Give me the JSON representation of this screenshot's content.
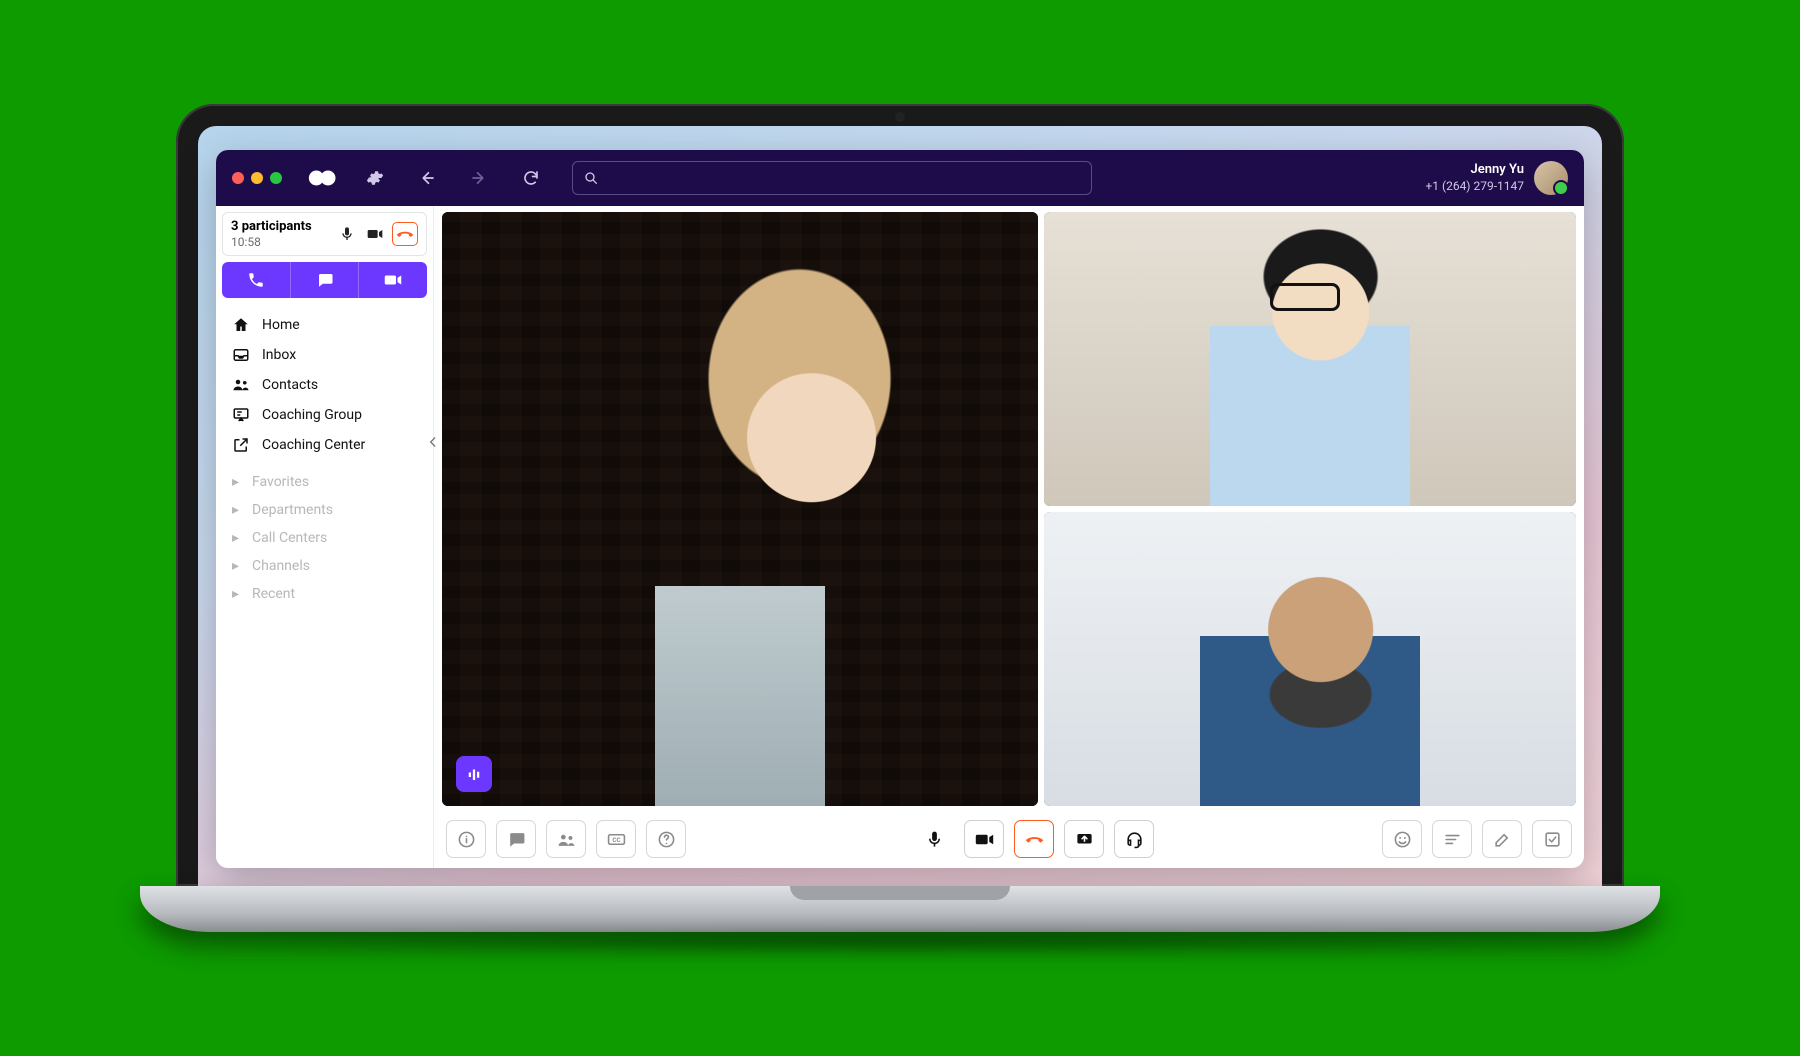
{
  "user": {
    "name": "Jenny Yu",
    "phone": "+1 (264) 279-1147"
  },
  "search": {
    "placeholder": ""
  },
  "call": {
    "participants_label": "3 participants",
    "duration": "10:58"
  },
  "nav": {
    "items": [
      {
        "label": "Home"
      },
      {
        "label": "Inbox"
      },
      {
        "label": "Contacts"
      },
      {
        "label": "Coaching Group"
      },
      {
        "label": "Coaching Center"
      }
    ]
  },
  "groups": {
    "items": [
      {
        "label": "Favorites"
      },
      {
        "label": "Departments"
      },
      {
        "label": "Call Centers"
      },
      {
        "label": "Channels"
      },
      {
        "label": "Recent"
      }
    ]
  },
  "icons": {
    "settings": "settings-icon",
    "back": "back-icon",
    "forward": "forward-icon",
    "refresh": "refresh-icon",
    "search": "search-icon",
    "phone": "phone-icon",
    "chat": "chat-icon",
    "video": "video-icon",
    "mic": "mic-icon",
    "hangup": "hangup-icon",
    "home": "home-icon",
    "inbox": "inbox-icon",
    "contacts": "contacts-icon",
    "whiteboard": "whiteboard-icon",
    "external": "external-link-icon"
  },
  "bottom_controls": {
    "left": [
      "info-icon",
      "chat-icon",
      "participants-icon",
      "cc-icon",
      "help-icon"
    ],
    "center": [
      "mic-icon",
      "video-icon",
      "hangup-icon",
      "share-screen-icon",
      "headset-icon"
    ],
    "right": [
      "emoji-icon",
      "notes-icon",
      "edit-icon",
      "task-icon"
    ]
  },
  "colors": {
    "accent": "#6c38ff",
    "hangup": "#ff5a1f",
    "titlebar": "#1e0b4a"
  }
}
